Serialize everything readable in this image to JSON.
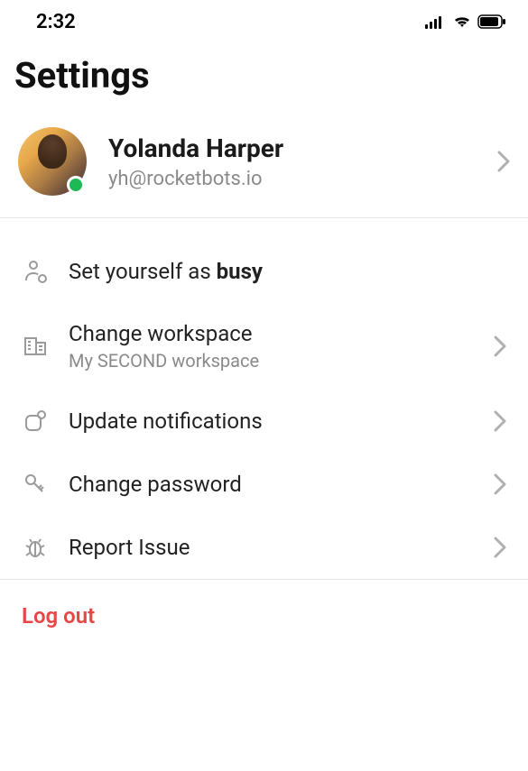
{
  "status_bar": {
    "time": "2:32"
  },
  "page": {
    "title": "Settings"
  },
  "profile": {
    "name": "Yolanda Harper",
    "email": "yh@rocketbots.io",
    "presence": "online"
  },
  "items": {
    "busy": {
      "label_prefix": "Set yourself as ",
      "label_bold": "busy"
    },
    "workspace": {
      "label": "Change workspace",
      "sub": "My SECOND workspace"
    },
    "notifications": {
      "label": "Update notifications"
    },
    "password": {
      "label": "Change password"
    },
    "report": {
      "label": "Report Issue"
    }
  },
  "logout": {
    "label": "Log out"
  }
}
